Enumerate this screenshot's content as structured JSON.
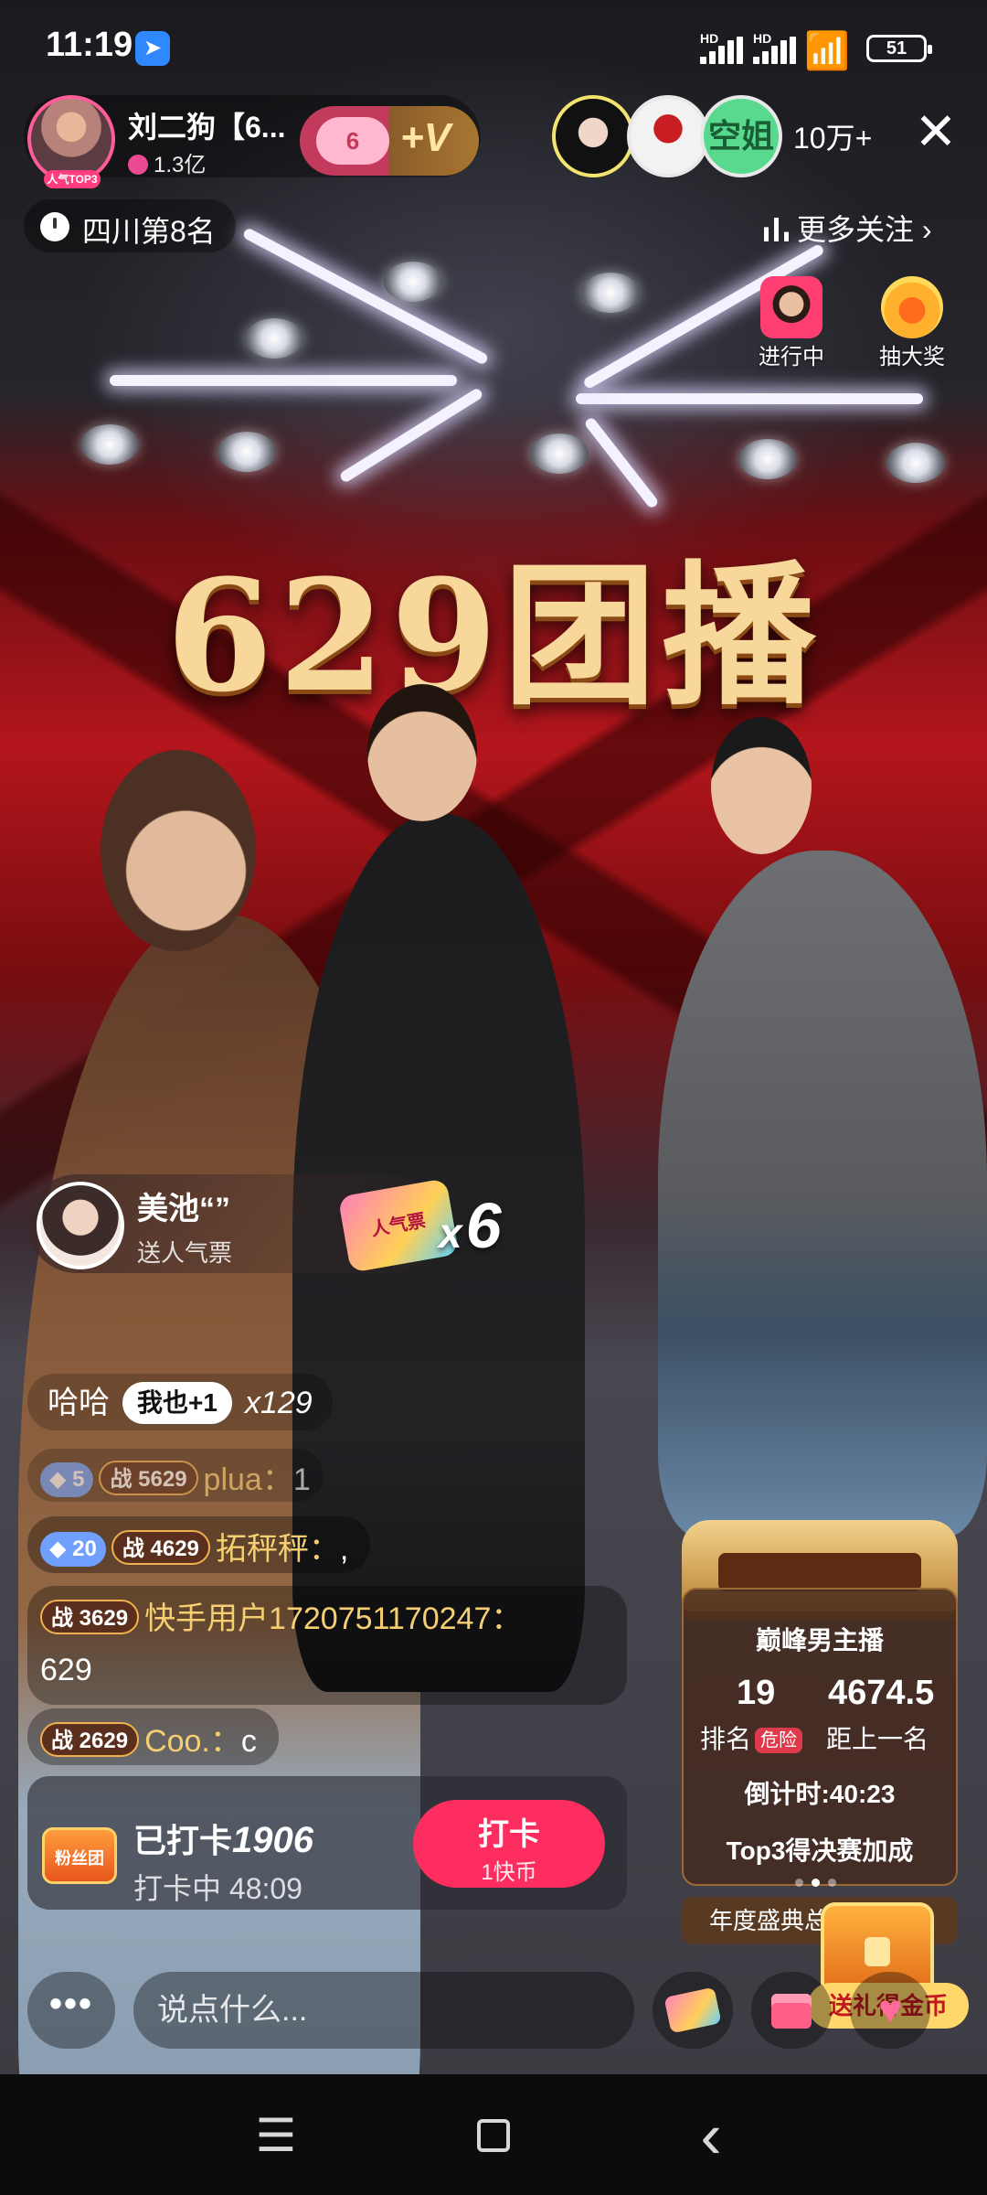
{
  "status_bar": {
    "time": "11:19",
    "sim1_label": "HD",
    "sim2_label": "HD",
    "battery": "51"
  },
  "anchor": {
    "name": "刘二狗【6...",
    "likes": "1.3亿",
    "avatar_tag": "人气TOP3",
    "fan_level": "6",
    "follow_label": "+V"
  },
  "viewers": {
    "third_label": "空姐",
    "count": "10万+"
  },
  "rank": {
    "text": "四川第8名",
    "more_follow": "更多关注"
  },
  "promos": {
    "live_label": "进行中",
    "lottery_label": "抽大奖"
  },
  "stage_title": "629团播",
  "gift": {
    "user": "美池“”",
    "action": "送人气票",
    "icon_text": "人气票",
    "count_prefix": "x",
    "count": "6"
  },
  "chat": [
    {
      "name": "哈哈",
      "metoo": "我也+1",
      "repeat": "x129"
    },
    {
      "diamond": "5",
      "war_level": "5629",
      "user": "plua：",
      "text": "1"
    },
    {
      "diamond": "20",
      "war_level": "4629",
      "user": "拓秤秤：",
      "text": ","
    },
    {
      "war_level": "3629",
      "user": "快手用户1720751170247：",
      "text": "629"
    },
    {
      "war_level": "2629",
      "user": "Coo.：",
      "text": "c"
    }
  ],
  "war_prefix": "战",
  "checkin": {
    "badge": "粉丝团",
    "title_prefix": "已打卡",
    "count": "1906",
    "status": "打卡中 48:09",
    "button_label": "打卡",
    "button_sub": "1快币"
  },
  "pk_rank": {
    "title": "巅峰男主播",
    "rank_value": "19",
    "rank_label": "排名",
    "danger_label": "危险",
    "gap_value": "4674.5",
    "gap_label": "距上一名",
    "countdown": "倒计时:40:23",
    "top3_text": "Top3得决赛加成",
    "annual_text": "年度盛典总"
  },
  "chest_label": "送礼得金币",
  "bottom_bar": {
    "more_label": "•••",
    "input_placeholder": "说点什么..."
  },
  "nav": {
    "menu": "☰",
    "back": "‹"
  },
  "colors": {
    "accent_pink": "#fd2d60",
    "gold_text": "#f6cf72",
    "stage_red": "#b3161c"
  }
}
